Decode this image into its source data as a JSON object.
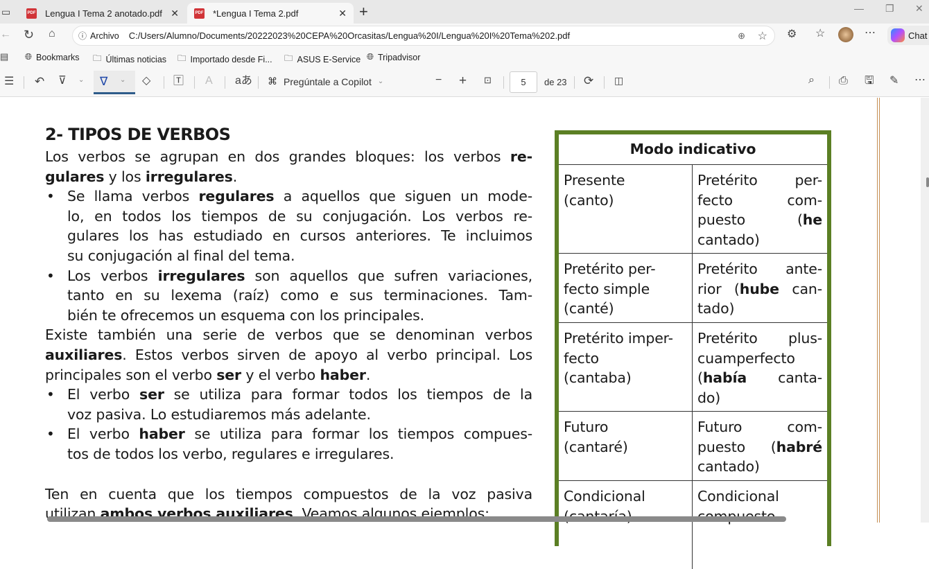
{
  "browser": {
    "tabs": [
      {
        "label": "Lengua I Tema 2 anotado.pdf",
        "active": false
      },
      {
        "label": "*Lengua I Tema 2.pdf",
        "active": true
      }
    ],
    "address": {
      "scheme_label": "Archivo",
      "url": "C:/Users/Alumno/Documents/20222023%20CEPA%20Orcasitas/Lengua%20I/Lengua%20I%20Tema%202.pdf"
    },
    "chat_label": "Chat",
    "bookmarks": [
      "Bookmarks",
      "Últimas noticias",
      "Importado desde Fi...",
      "ASUS E-Service",
      "Tripadvisor"
    ]
  },
  "pdf_toolbar": {
    "copilot_label": "Pregúntale a Copilot",
    "page": "5",
    "page_total": "de 23"
  },
  "document": {
    "heading": "2- TIPOS DE VERBOS",
    "blocks": [
      {
        "type": "p",
        "lines": [
          "Los verbos se agrupan en dos grandes bloques: los verbos **re-**",
          "**gulares** y los **irregulares**."
        ]
      },
      {
        "type": "bullet",
        "lines": [
          "Se llama verbos **regulares** a aquellos que siguen un mode-",
          "lo, en todos los tiempos de su conjugación. Los verbos re-",
          "gulares los has estudiado en cursos anteriores. Te incluimos",
          "su conjugación al final del tema."
        ]
      },
      {
        "type": "bullet",
        "lines": [
          "Los verbos **irregulares** son aquellos que sufren variaciones,",
          "tanto en su lexema (raíz) como e sus terminaciones. Tam-",
          "bién te ofrecemos un esquema con los principales."
        ]
      },
      {
        "type": "p",
        "lines": [
          "Existe también una serie de verbos que se denominan verbos",
          "**auxiliares**. Estos verbos sirven de apoyo al verbo principal. Los",
          "principales son el verbo **ser** y el verbo **haber**."
        ]
      },
      {
        "type": "bullet",
        "lines": [
          "El verbo **ser** se utiliza para formar todos los tiempos de la",
          "voz pasiva. Lo estudiaremos más adelante."
        ]
      },
      {
        "type": "bullet",
        "lines": [
          "El verbo **haber** se utiliza para formar los tiempos compues-",
          "tos de todos los verbo, regulares e irregulares."
        ]
      },
      {
        "type": "gap",
        "lines": []
      },
      {
        "type": "p",
        "lines": [
          "Ten en cuenta que los tiempos compuestos de la voz pasiva",
          "utilizan **ambos verbos auxiliares**. Veamos algunos ejemplos:"
        ]
      }
    ],
    "table": {
      "title": "Modo indicativo",
      "rows": [
        [
          [
            "Presente",
            "(canto)"
          ],
          [
            "Pretérito per-",
            "fecto com-",
            "puesto (**he**",
            "cantado)"
          ]
        ],
        [
          [
            "Pretérito per-",
            "fecto simple",
            "(canté)"
          ],
          [
            "Pretérito ante-",
            "rior (**hube** can-",
            "tado)"
          ]
        ],
        [
          [
            "Pretérito imper-",
            "fecto",
            "(cantaba)"
          ],
          [
            "Pretérito plus-",
            "cuamperfecto",
            "(**había** canta-",
            "do)"
          ]
        ],
        [
          [
            "Futuro",
            "(cantaré)"
          ],
          [
            "Futuro com-",
            "puesto (**habré**",
            "cantado)"
          ]
        ],
        [
          [
            "Condicional",
            "(cantaría)"
          ],
          [
            "Condicional",
            "compuesto"
          ]
        ]
      ]
    }
  },
  "colors": {
    "table_border": "#5b7f24",
    "page_edge": "#c58e53",
    "pdf_icon": "#d13438"
  }
}
